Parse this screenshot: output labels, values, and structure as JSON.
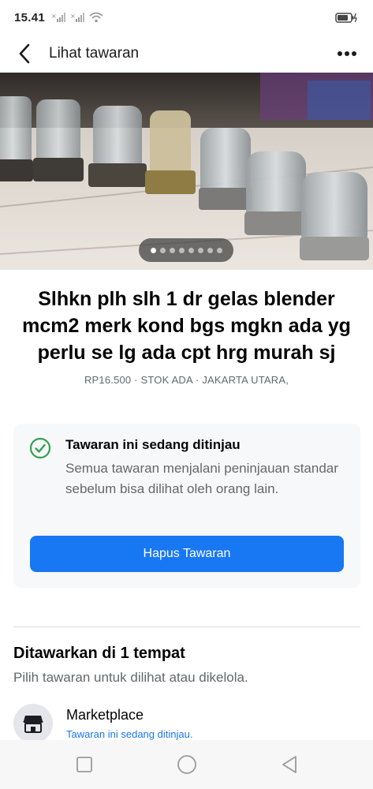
{
  "status_bar": {
    "time": "15.41",
    "signal_1": "x.ıl",
    "signal_2": "x.ıl"
  },
  "app_bar": {
    "title": "Lihat tawaran",
    "back_icon": "chevron-left-icon",
    "more_icon": "more-horizontal-icon"
  },
  "hero": {
    "image_description_icon": "photo",
    "dot_count": 8,
    "active_dot": 0
  },
  "listing": {
    "title": "Slhkn plh slh 1 dr gelas blender mcm2 merk kond bgs mgkn ada yg perlu se lg ada cpt hrg murah sj",
    "meta": "RP16.500 · STOK ADA · JAKARTA UTARA,"
  },
  "review": {
    "title": "Tawaran ini sedang ditinjau",
    "body": "Semua tawaran menjalani peninjauan standar sebelum bisa dilihat oleh orang lain.",
    "button_label": "Hapus Tawaran"
  },
  "offered_section": {
    "title": "Ditawarkan di 1 tempat",
    "subtitle": "Pilih tawaran untuk dilihat atau dikelola.",
    "places": [
      {
        "name": "Marketplace",
        "status": "Tawaran ini sedang ditinjau."
      }
    ]
  },
  "colors": {
    "accent": "#1877f2",
    "success": "#31a24c",
    "secondary_text": "#65676b"
  }
}
